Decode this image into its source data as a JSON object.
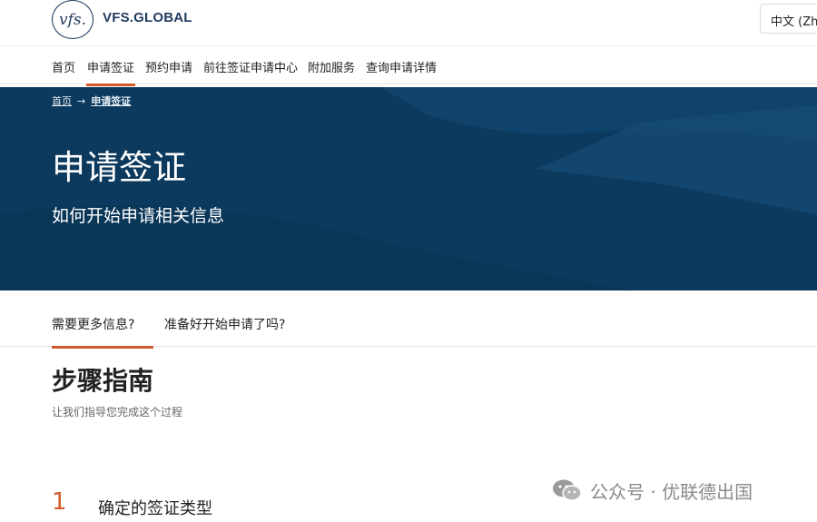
{
  "header": {
    "logo_mark": "vfs.",
    "logo_text": "VFS.GLOBAL",
    "language": "中文 (Zho"
  },
  "nav": {
    "items": [
      {
        "label": "首页"
      },
      {
        "label": "申请签证"
      },
      {
        "label": "预约申请"
      },
      {
        "label": "前往签证申请中心"
      },
      {
        "label": "附加服务"
      },
      {
        "label": "查询申请详情"
      }
    ],
    "active_index": 1
  },
  "hero": {
    "breadcrumb": {
      "home": "首页",
      "separator": "→",
      "current": "申请签证"
    },
    "title": "申请签证",
    "subtitle": "如何开始申请相关信息"
  },
  "tabs": {
    "items": [
      {
        "label": "需要更多信息?"
      },
      {
        "label": "准备好开始申请了吗?"
      }
    ],
    "active_index": 0
  },
  "section": {
    "title": "步骤指南",
    "subtitle": "让我们指导您完成这个过程"
  },
  "step": {
    "number": "1",
    "label": "确定的签证类型"
  },
  "watermark": {
    "text": "公众号 · 优联德出国"
  },
  "colors": {
    "brand_navy": "#1f3a5f",
    "hero_bg": "#0c3a5e",
    "accent": "#d45a2a"
  }
}
